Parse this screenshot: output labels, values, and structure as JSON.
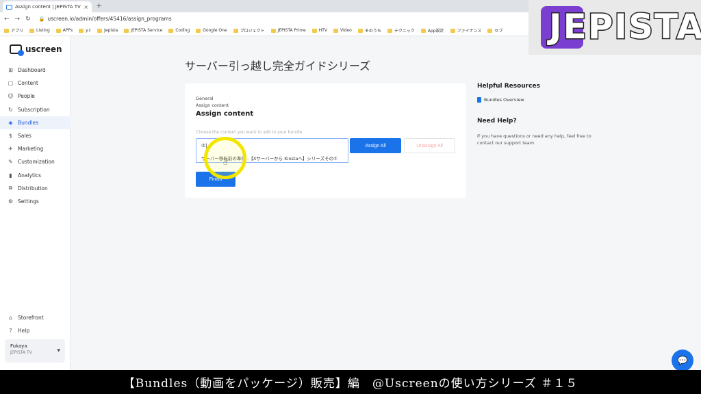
{
  "browser": {
    "tab_title": "Assign content | JEPISTA TV",
    "tab_close": "×",
    "new_tab": "+",
    "url": "uscreen.io/admin/offers/45416/assign_programs",
    "bookmarks": [
      "アプリ",
      "Listing",
      "APPs",
      "y.c",
      "Jepista",
      "JEPISTA Service",
      "Coding",
      "Google One",
      "プロジェクト",
      "JEPISTA Prime",
      "HTV",
      "Video",
      "そのうち",
      "テクニック",
      "App設計",
      "ファイナンス",
      "セブ"
    ]
  },
  "overlay": {
    "logo_text": "JEPISTA"
  },
  "sidebar": {
    "brand": "uscreen",
    "items": [
      {
        "label": "Dashboard",
        "icon": "⊞"
      },
      {
        "label": "Content",
        "icon": "▢"
      },
      {
        "label": "People",
        "icon": "☺"
      },
      {
        "label": "Subscription",
        "icon": "↻"
      },
      {
        "label": "Bundles",
        "icon": "◈"
      },
      {
        "label": "Sales",
        "icon": "$"
      },
      {
        "label": "Marketing",
        "icon": "✈"
      },
      {
        "label": "Customization",
        "icon": "✎"
      },
      {
        "label": "Analytics",
        "icon": "▮"
      },
      {
        "label": "Distribution",
        "icon": "⧉"
      },
      {
        "label": "Settings",
        "icon": "⚙"
      }
    ],
    "bottom_items": [
      {
        "label": "Storefront",
        "icon": "⌂"
      },
      {
        "label": "Help",
        "icon": "?"
      }
    ],
    "account": {
      "name": "Fukaya",
      "org": "JEPISTA TV"
    }
  },
  "main": {
    "page_title": "サーバー引っ越し完全ガイドシリーズ",
    "card": {
      "crumb1": "General",
      "crumb2": "Assign content",
      "title": "Assign content",
      "hint": "Choose the content you want to add to your bundle.",
      "search_value": "②|",
      "suggestion": "サーバー移転前の準備 -【Xサーバーから Kinstaへ】シリーズその②",
      "assign_all": "Assign All",
      "unassign_all": "Unassign All",
      "finish": "Finish"
    }
  },
  "resources": {
    "title": "Helpful Resources",
    "link": "Bundles Overview",
    "help_title": "Need Help?",
    "help_text": "If you have questions or need any help, feel free to contact our support team"
  },
  "caption": "【Bundles（動画をパッケージ）販売】編　@Uscreenの使い方シリーズ ＃１５",
  "colors": {
    "accent": "#1a73e8",
    "highlight": "#f2e600",
    "logo_purple": "#7a3fd0"
  }
}
